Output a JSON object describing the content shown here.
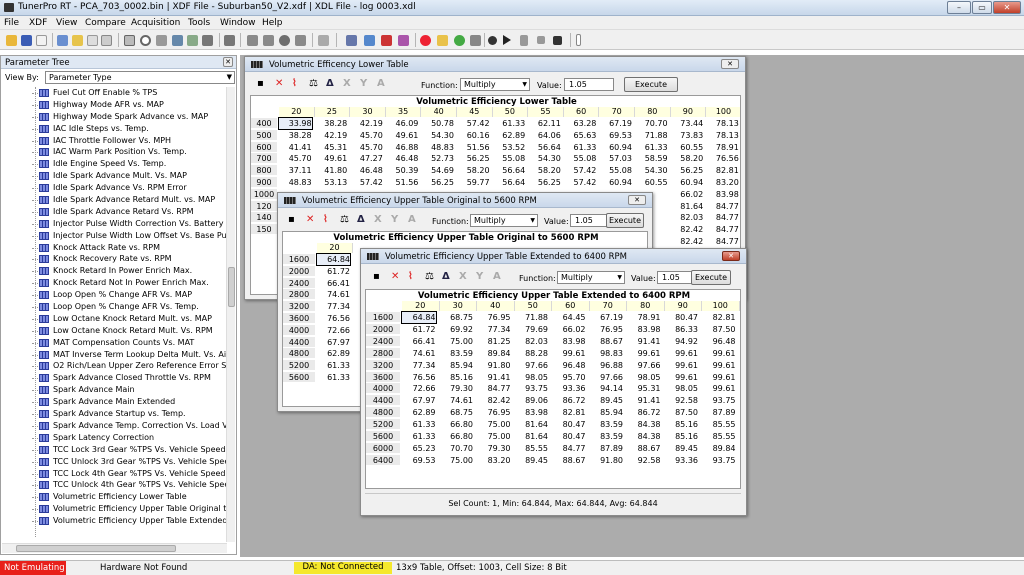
{
  "app_title": "TunerPro RT - PCA_703_0002.bin | XDF File - Suburban50_V2.xdf | XDL File - log 0003.xdl",
  "window_buttons": {
    "min": "–",
    "max": "▭",
    "close": "✕"
  },
  "menu": [
    "File",
    "XDF",
    "View",
    "Compare",
    "Acquisition",
    "Tools",
    "Window",
    "Help"
  ],
  "ptree": {
    "title": "Parameter Tree",
    "close": "✕",
    "view_by_label": "View By:",
    "view_by_value": "Parameter Type",
    "items": [
      "Fuel Cut Off Enable % TPS",
      "Highway Mode AFR vs. MAP",
      "Highway Mode Spark Advance vs. MAP",
      "IAC Idle Steps vs. Temp.",
      "IAC Throttle Follower Vs. MPH",
      "IAC Warm Park Position Vs. Temp.",
      "Idle Engine Speed Vs. Temp.",
      "Idle Spark Advance Mult. Vs. MAP",
      "Idle Spark Advance Vs. RPM Error",
      "Idle Spark Advance Retard Mult. vs. MAP",
      "Idle Spark Advance Retard Vs. RPM",
      "Injector Pulse Width Correction Vs. Battery Volt",
      "Injector Pulse Width Low Offset Vs. Base Pulse",
      "Knock Attack Rate vs. RPM",
      "Knock Recovery Rate vs. RPM",
      "Knock Retard In Power Enrich Max.",
      "Knock Retard Not In Power Enrich Max.",
      "Loop Open % Change AFR Vs. MAP",
      "Loop Open % Change AFR Vs. Temp.",
      "Low Octane Knock Retard Mult. vs. MAP",
      "Low Octane Knock Retard Mult. Vs. RPM",
      "MAT Compensation Counts Vs. MAT",
      "MAT Inverse Term Lookup Delta Mult. Vs. Airflov",
      "O2 Rich/Lean Upper Zero Reference Error Slow",
      "Spark Advance Closed Throttle Vs. RPM",
      "Spark Advance Main",
      "Spark Advance Main Extended",
      "Spark Advance Startup vs. Temp.",
      "Spark Advance Temp. Correction Vs. Load Vs. T",
      "Spark Latency Correction",
      "TCC Lock 3rd Gear %TPS Vs. Vehicle Speed",
      "TCC Unlock 3rd Gear %TPS Vs. Vehicle Speed",
      "TCC Lock 4th Gear %TPS Vs. Vehicle Speed",
      "TCC Unlock 4th Gear %TPS Vs. Vehicle Speed",
      "Volumetric Efficiency Lower Table",
      "Volumetric Efficiency Upper Table Original to 560",
      "Volumetric Efficiency Upper Table Extended to 6"
    ]
  },
  "toolbar_labels": {
    "function": "Function:",
    "value": "Value:",
    "execute": "Execute"
  },
  "win1": {
    "title": "Volumetric Efficency Lower Table",
    "close": "✕",
    "function": "Multiply",
    "value": "1.05",
    "grid_title": "Volumetric Efficiency Lower Table",
    "cols": [
      "20",
      "25",
      "30",
      "35",
      "40",
      "45",
      "50",
      "55",
      "60",
      "70",
      "80",
      "90",
      "100"
    ],
    "rows": [
      "400",
      "500",
      "600",
      "700",
      "800",
      "900",
      "1000",
      "1200",
      "1400",
      "1600"
    ],
    "data": [
      [
        "33.98",
        "38.28",
        "42.19",
        "46.09",
        "50.78",
        "57.42",
        "61.33",
        "62.11",
        "63.28",
        "67.19",
        "70.70",
        "73.44",
        "78.13"
      ],
      [
        "38.28",
        "42.19",
        "45.70",
        "49.61",
        "54.30",
        "60.16",
        "62.89",
        "64.06",
        "65.63",
        "69.53",
        "71.88",
        "73.83",
        "78.13"
      ],
      [
        "41.41",
        "45.31",
        "45.70",
        "46.88",
        "48.83",
        "51.56",
        "53.52",
        "56.64",
        "61.33",
        "60.94",
        "61.33",
        "60.55",
        "78.91"
      ],
      [
        "45.70",
        "49.61",
        "47.27",
        "46.48",
        "52.73",
        "56.25",
        "55.08",
        "54.30",
        "55.08",
        "57.03",
        "58.59",
        "58.20",
        "76.56"
      ],
      [
        "37.11",
        "41.80",
        "46.48",
        "50.39",
        "54.69",
        "58.20",
        "56.64",
        "58.20",
        "57.42",
        "55.08",
        "54.30",
        "56.25",
        "82.81"
      ],
      [
        "48.83",
        "53.13",
        "57.42",
        "51.56",
        "56.25",
        "59.77",
        "56.64",
        "56.25",
        "57.42",
        "60.94",
        "60.55",
        "60.94",
        "83.20"
      ],
      [
        "",
        "",
        "",
        "",
        "",
        "",
        "",
        "",
        "",
        "",
        "",
        "66.02",
        "83.98"
      ],
      [
        "",
        "",
        "",
        "",
        "",
        "",
        "",
        "",
        "",
        "",
        "",
        "81.64",
        "84.77"
      ],
      [
        "",
        "",
        "",
        "",
        "",
        "",
        "",
        "",
        "",
        "",
        "",
        "82.03",
        "84.77"
      ],
      [
        "",
        "",
        "",
        "",
        "",
        "",
        "",
        "",
        "",
        "",
        "",
        "82.42",
        "84.77"
      ]
    ],
    "rows_visible_short": [
      "1000",
      "120",
      "140",
      "150",
      "160"
    ],
    "extra_right": [
      [
        "",
        "82.42",
        "84.77"
      ],
      [
        "",
        "82.42",
        "84.77"
      ]
    ]
  },
  "win2": {
    "title": "Volumetric Efficiency Upper Table Original to 5600 RPM",
    "close": "✕",
    "function": "Multiply",
    "value": "1.05",
    "grid_title": "Volumetric Efficiency Upper Table Original to 5600 RPM",
    "col0": "20",
    "rows": [
      "1600",
      "2000",
      "2400",
      "2800",
      "3200",
      "3600",
      "4000",
      "4400",
      "4800",
      "5200",
      "5600"
    ],
    "data": [
      "64.84",
      "61.72",
      "66.41",
      "74.61",
      "77.34",
      "76.56",
      "72.66",
      "67.97",
      "62.89",
      "61.33",
      "61.33"
    ]
  },
  "win3": {
    "title": "Volumetric Efficiency Upper Table Extended to 6400 RPM",
    "close": "✕",
    "function": "Multiply",
    "value": "1.05",
    "grid_title": "Volumetric Efficiency Upper Table Extended to 6400 RPM",
    "cols": [
      "20",
      "30",
      "40",
      "50",
      "60",
      "70",
      "80",
      "90",
      "100"
    ],
    "rows": [
      "1600",
      "2000",
      "2400",
      "2800",
      "3200",
      "3600",
      "4000",
      "4400",
      "4800",
      "5200",
      "5600",
      "6000",
      "6400"
    ],
    "data": [
      [
        "64.84",
        "68.75",
        "76.95",
        "71.88",
        "64.45",
        "67.19",
        "78.91",
        "80.47",
        "82.81"
      ],
      [
        "61.72",
        "69.92",
        "77.34",
        "79.69",
        "66.02",
        "76.95",
        "83.98",
        "86.33",
        "87.50"
      ],
      [
        "66.41",
        "75.00",
        "81.25",
        "82.03",
        "83.98",
        "88.67",
        "91.41",
        "94.92",
        "96.48"
      ],
      [
        "74.61",
        "83.59",
        "89.84",
        "88.28",
        "99.61",
        "98.83",
        "99.61",
        "99.61",
        "99.61"
      ],
      [
        "77.34",
        "85.94",
        "91.80",
        "97.66",
        "96.48",
        "96.88",
        "97.66",
        "99.61",
        "99.61"
      ],
      [
        "76.56",
        "85.16",
        "91.41",
        "98.05",
        "95.70",
        "97.66",
        "98.05",
        "99.61",
        "99.61"
      ],
      [
        "72.66",
        "79.30",
        "84.77",
        "93.75",
        "93.36",
        "94.14",
        "95.31",
        "98.05",
        "99.61"
      ],
      [
        "67.97",
        "74.61",
        "82.42",
        "89.06",
        "86.72",
        "89.45",
        "91.41",
        "92.58",
        "93.75"
      ],
      [
        "62.89",
        "68.75",
        "76.95",
        "83.98",
        "82.81",
        "85.94",
        "86.72",
        "87.50",
        "87.89"
      ],
      [
        "61.33",
        "66.80",
        "75.00",
        "81.64",
        "80.47",
        "83.59",
        "84.38",
        "85.16",
        "85.55"
      ],
      [
        "61.33",
        "66.80",
        "75.00",
        "81.64",
        "80.47",
        "83.59",
        "84.38",
        "85.16",
        "85.55"
      ],
      [
        "65.23",
        "70.70",
        "79.30",
        "85.55",
        "84.77",
        "87.89",
        "88.67",
        "89.45",
        "89.84"
      ],
      [
        "69.53",
        "75.00",
        "83.20",
        "89.45",
        "88.67",
        "91.80",
        "92.58",
        "93.36",
        "93.75"
      ]
    ],
    "status": "Sel Count: 1, Min: 64.844, Max: 64.844, Avg: 64.844"
  },
  "statusbar": {
    "emulating": "Not Emulating",
    "hardware": "Hardware Not Found",
    "da": "DA: Not Connected",
    "info": "13x9 Table, Offset: 1003,  Cell Size: 8 Bit"
  },
  "colors": {
    "emulating_bg": "#e8201a",
    "da_bg": "#f5e82c",
    "header_cell": "#ffffe0"
  }
}
